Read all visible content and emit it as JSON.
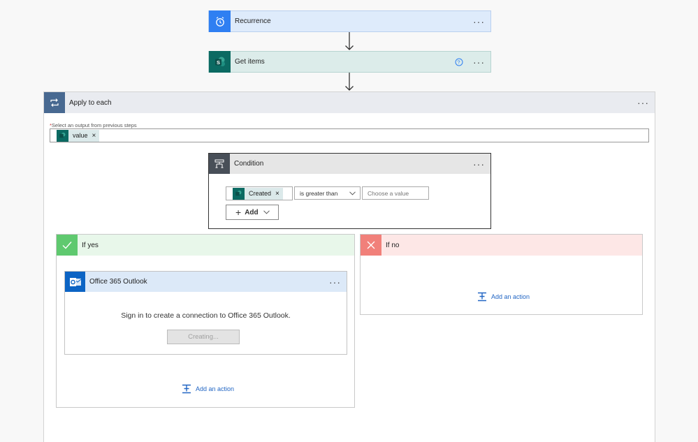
{
  "steps": {
    "recurrence": {
      "title": "Recurrence",
      "menu": "···",
      "icon": "alarm-clock-icon",
      "color": "#2f7ff2"
    },
    "get_items": {
      "title": "Get items",
      "menu": "···",
      "help": "?",
      "icon": "sharepoint-icon",
      "color": "#0b6a62"
    },
    "apply_each": {
      "title": "Apply to each",
      "menu": "···",
      "icon": "loop-icon",
      "color": "#486991",
      "select_label": "Select an output from previous steps",
      "required_mark": "*",
      "token": {
        "label": "value",
        "remove": "×"
      }
    },
    "condition": {
      "title": "Condition",
      "menu": "···",
      "icon": "condition-icon",
      "token": {
        "label": "Created",
        "remove": "×"
      },
      "operator": "is greater than",
      "value_placeholder": "Choose a value",
      "add_label": "Add"
    },
    "if_yes": {
      "title": "If yes",
      "color": "#5fc96f",
      "outlook": {
        "title": "Office 365 Outlook",
        "menu": "···",
        "message": "Sign in to create a connection to Office 365 Outlook.",
        "button": "Creating..."
      },
      "add_action": "Add an action"
    },
    "if_no": {
      "title": "If no",
      "color": "#f1807a",
      "add_action": "Add an action"
    }
  }
}
